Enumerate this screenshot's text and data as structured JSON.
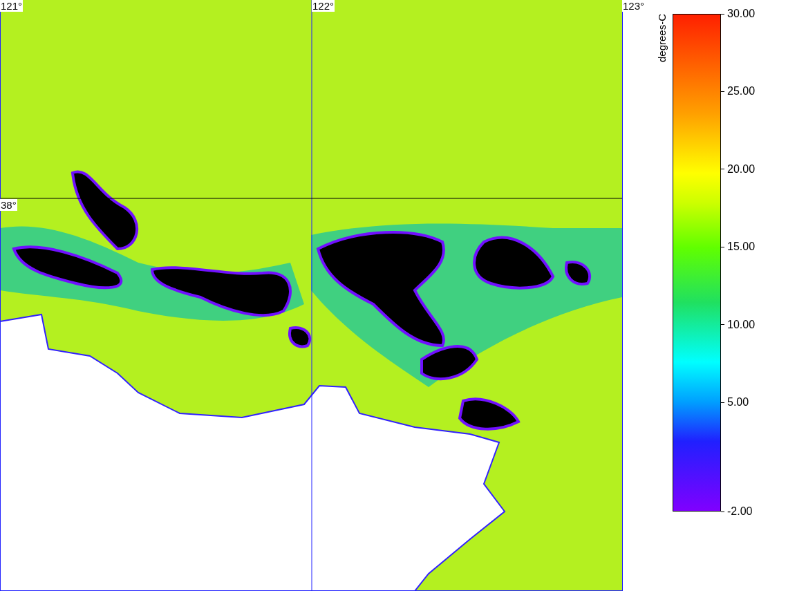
{
  "map": {
    "longitude_labels": [
      "121°",
      "122°",
      "123°"
    ],
    "latitude_labels": [
      "38°"
    ]
  },
  "legend": {
    "unit": "degrees-C",
    "ticks": [
      "30.00",
      "25.00",
      "20.00",
      "15.00",
      "10.00",
      "5.00",
      "-2.00"
    ]
  }
}
